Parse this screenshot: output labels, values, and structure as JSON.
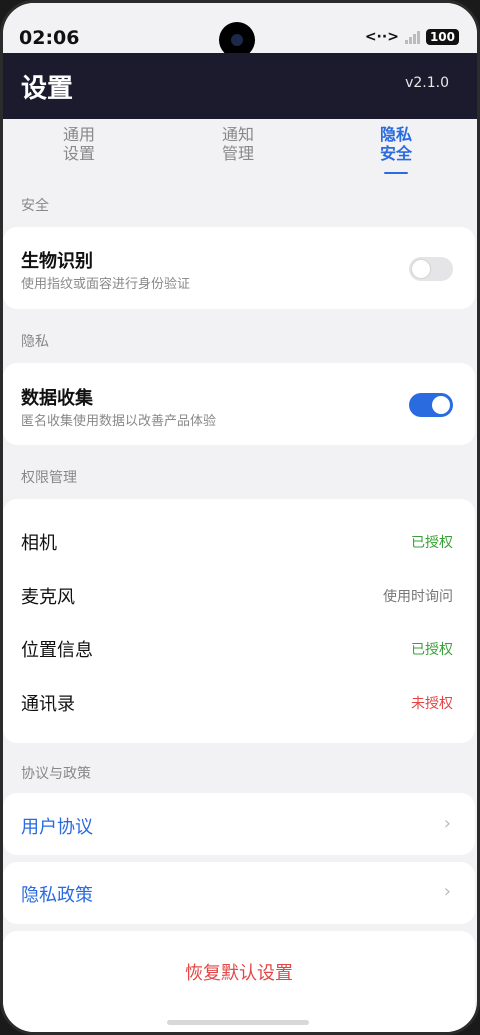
{
  "status": {
    "time": "02:06",
    "net": "<··>",
    "battery": "100"
  },
  "header": {
    "title": "设置",
    "version": "v2.1.0"
  },
  "tabs": [
    {
      "line1": "通用",
      "line2": "设置"
    },
    {
      "line1": "通知",
      "line2": "管理"
    },
    {
      "line1": "隐私",
      "line2": "安全"
    }
  ],
  "sections": {
    "security": "安全",
    "privacy": "隐私",
    "permissions": "权限管理",
    "policy": "协议与政策"
  },
  "biometrics": {
    "title": "生物识别",
    "desc": "使用指纹或面容进行身份验证",
    "enabled": false
  },
  "data_collection": {
    "title": "数据收集",
    "desc": "匿名收集使用数据以改善产品体验",
    "enabled": true
  },
  "permissions": [
    {
      "name": "相机",
      "status": "已授权",
      "color": "#3aa13a"
    },
    {
      "name": "麦克风",
      "status": "使用时询问",
      "color": "#777777"
    },
    {
      "name": "位置信息",
      "status": "已授权",
      "color": "#3aa13a"
    },
    {
      "name": "通讯录",
      "status": "未授权",
      "color": "#e64545"
    }
  ],
  "links": {
    "user_agreement": "用户协议",
    "privacy_policy": "隐私政策"
  },
  "reset_label": "恢复默认设置",
  "colors": {
    "accent": "#2a6be0",
    "header_bg": "#1c1b2e",
    "danger": "#e64545",
    "success": "#3aa13a"
  }
}
